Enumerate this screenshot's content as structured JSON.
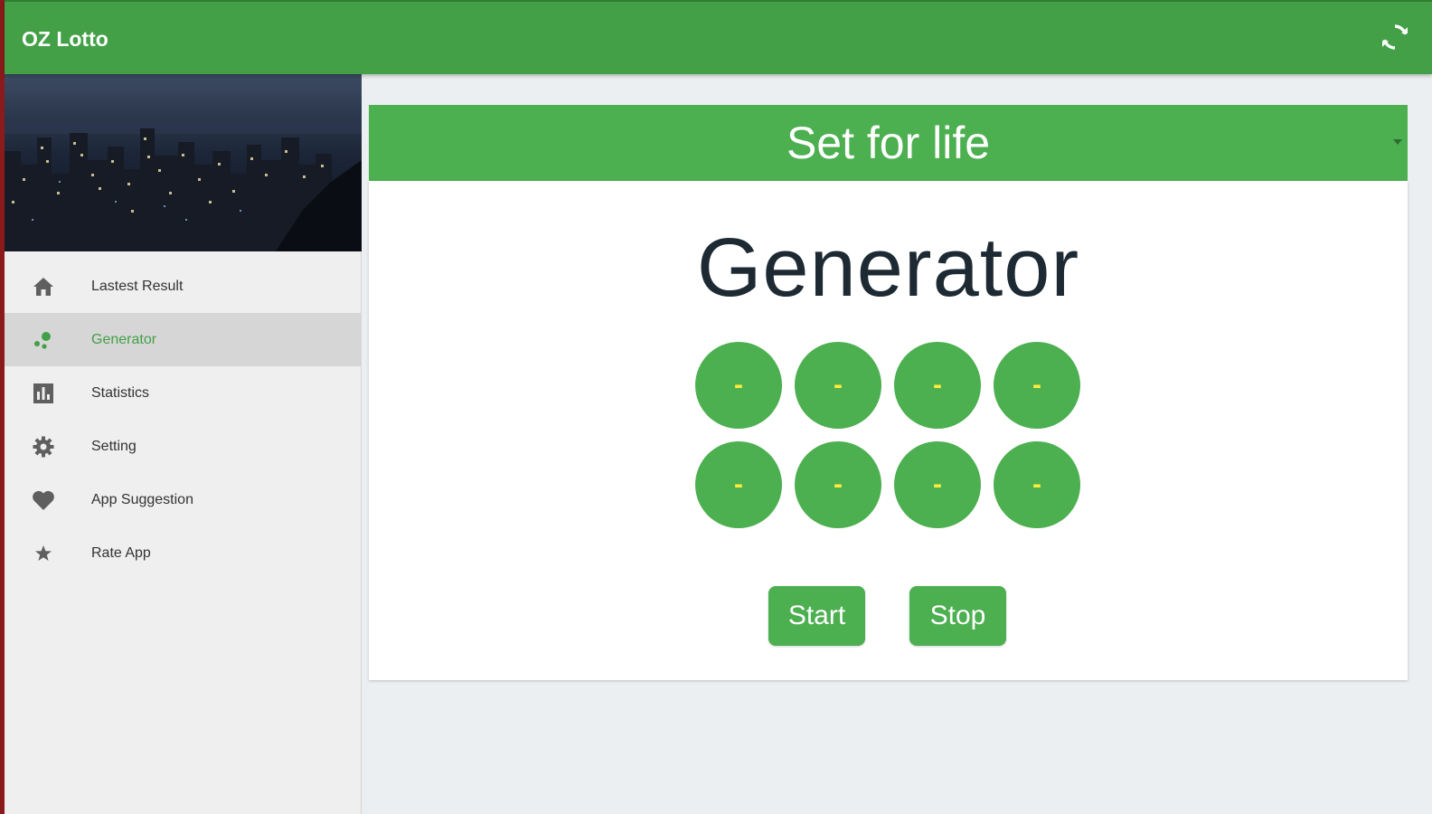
{
  "appbar": {
    "title": "OZ Lotto",
    "refresh_icon": "refresh-icon",
    "color": "#43a047"
  },
  "sidebar": {
    "hero_image": "night-city-skyline",
    "items": [
      {
        "label": "Lastest Result",
        "icon": "home-icon",
        "active": false
      },
      {
        "label": "Generator",
        "icon": "dots-icon",
        "active": true
      },
      {
        "label": "Statistics",
        "icon": "bar-chart-icon",
        "active": false
      },
      {
        "label": "Setting",
        "icon": "gear-icon",
        "active": false
      },
      {
        "label": "App Suggestion",
        "icon": "heart-icon",
        "active": false
      },
      {
        "label": "Rate App",
        "icon": "star-icon",
        "active": false
      }
    ]
  },
  "main": {
    "game_select": {
      "selected": "Set for life"
    },
    "title": "Generator",
    "balls": [
      "-",
      "-",
      "-",
      "-",
      "-",
      "-",
      "-",
      "-"
    ],
    "start_label": "Start",
    "stop_label": "Stop"
  },
  "colors": {
    "accent": "#4caf50",
    "ball_text": "#ffeb3b",
    "background": "#eceff1"
  }
}
